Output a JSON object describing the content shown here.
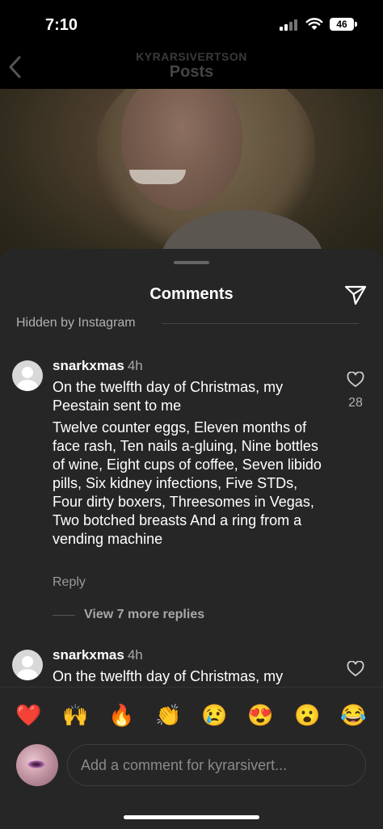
{
  "status_bar": {
    "time": "7:10",
    "battery": "46"
  },
  "header": {
    "username": "KYRARSIVERTSON",
    "title": "Posts"
  },
  "sheet": {
    "title": "Comments",
    "hidden_label": "Hidden by Instagram"
  },
  "comments": [
    {
      "username": "snarkxmas",
      "time": "4h",
      "text_1": "On the twelfth day of Christmas, my Peestain sent to me",
      "text_2": "Twelve counter eggs, Eleven months of face rash, Ten nails a-gluing, Nine bottles of wine, Eight cups of coffee, Seven libido pills, Six kidney infections, Five STDs, Four dirty boxers, Threesomes in Vegas, Two botched breasts And a ring from a vending machine",
      "likes": "28",
      "reply_label": "Reply",
      "view_replies": "View 7 more replies"
    },
    {
      "username": "snarkxmas",
      "time": "4h",
      "text_1": "On the twelfth day of Christmas, my"
    }
  ],
  "emojis": [
    "❤️",
    "🙌",
    "🔥",
    "👏",
    "😢",
    "😍",
    "😮",
    "😂"
  ],
  "composer": {
    "placeholder": "Add a comment for kyrarsivert..."
  },
  "colors": {
    "sheet_bg": "#262626",
    "text": "#ffffff",
    "muted": "#a8a8a8"
  }
}
